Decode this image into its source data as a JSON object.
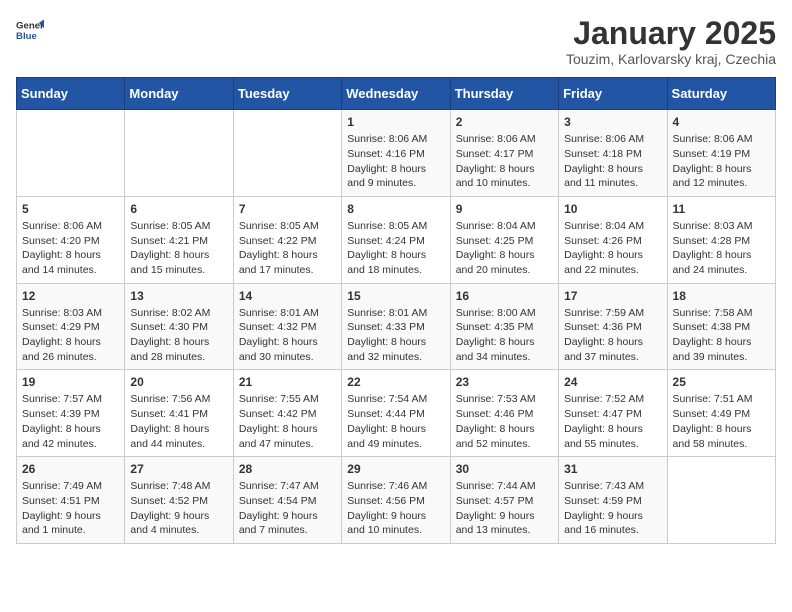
{
  "header": {
    "logo_general": "General",
    "logo_blue": "Blue",
    "month_title": "January 2025",
    "location": "Touzim, Karlovarsky kraj, Czechia"
  },
  "days_of_week": [
    "Sunday",
    "Monday",
    "Tuesday",
    "Wednesday",
    "Thursday",
    "Friday",
    "Saturday"
  ],
  "weeks": [
    [
      {
        "day": "",
        "content": ""
      },
      {
        "day": "",
        "content": ""
      },
      {
        "day": "",
        "content": ""
      },
      {
        "day": "1",
        "content": "Sunrise: 8:06 AM\nSunset: 4:16 PM\nDaylight: 8 hours\nand 9 minutes."
      },
      {
        "day": "2",
        "content": "Sunrise: 8:06 AM\nSunset: 4:17 PM\nDaylight: 8 hours\nand 10 minutes."
      },
      {
        "day": "3",
        "content": "Sunrise: 8:06 AM\nSunset: 4:18 PM\nDaylight: 8 hours\nand 11 minutes."
      },
      {
        "day": "4",
        "content": "Sunrise: 8:06 AM\nSunset: 4:19 PM\nDaylight: 8 hours\nand 12 minutes."
      }
    ],
    [
      {
        "day": "5",
        "content": "Sunrise: 8:06 AM\nSunset: 4:20 PM\nDaylight: 8 hours\nand 14 minutes."
      },
      {
        "day": "6",
        "content": "Sunrise: 8:05 AM\nSunset: 4:21 PM\nDaylight: 8 hours\nand 15 minutes."
      },
      {
        "day": "7",
        "content": "Sunrise: 8:05 AM\nSunset: 4:22 PM\nDaylight: 8 hours\nand 17 minutes."
      },
      {
        "day": "8",
        "content": "Sunrise: 8:05 AM\nSunset: 4:24 PM\nDaylight: 8 hours\nand 18 minutes."
      },
      {
        "day": "9",
        "content": "Sunrise: 8:04 AM\nSunset: 4:25 PM\nDaylight: 8 hours\nand 20 minutes."
      },
      {
        "day": "10",
        "content": "Sunrise: 8:04 AM\nSunset: 4:26 PM\nDaylight: 8 hours\nand 22 minutes."
      },
      {
        "day": "11",
        "content": "Sunrise: 8:03 AM\nSunset: 4:28 PM\nDaylight: 8 hours\nand 24 minutes."
      }
    ],
    [
      {
        "day": "12",
        "content": "Sunrise: 8:03 AM\nSunset: 4:29 PM\nDaylight: 8 hours\nand 26 minutes."
      },
      {
        "day": "13",
        "content": "Sunrise: 8:02 AM\nSunset: 4:30 PM\nDaylight: 8 hours\nand 28 minutes."
      },
      {
        "day": "14",
        "content": "Sunrise: 8:01 AM\nSunset: 4:32 PM\nDaylight: 8 hours\nand 30 minutes."
      },
      {
        "day": "15",
        "content": "Sunrise: 8:01 AM\nSunset: 4:33 PM\nDaylight: 8 hours\nand 32 minutes."
      },
      {
        "day": "16",
        "content": "Sunrise: 8:00 AM\nSunset: 4:35 PM\nDaylight: 8 hours\nand 34 minutes."
      },
      {
        "day": "17",
        "content": "Sunrise: 7:59 AM\nSunset: 4:36 PM\nDaylight: 8 hours\nand 37 minutes."
      },
      {
        "day": "18",
        "content": "Sunrise: 7:58 AM\nSunset: 4:38 PM\nDaylight: 8 hours\nand 39 minutes."
      }
    ],
    [
      {
        "day": "19",
        "content": "Sunrise: 7:57 AM\nSunset: 4:39 PM\nDaylight: 8 hours\nand 42 minutes."
      },
      {
        "day": "20",
        "content": "Sunrise: 7:56 AM\nSunset: 4:41 PM\nDaylight: 8 hours\nand 44 minutes."
      },
      {
        "day": "21",
        "content": "Sunrise: 7:55 AM\nSunset: 4:42 PM\nDaylight: 8 hours\nand 47 minutes."
      },
      {
        "day": "22",
        "content": "Sunrise: 7:54 AM\nSunset: 4:44 PM\nDaylight: 8 hours\nand 49 minutes."
      },
      {
        "day": "23",
        "content": "Sunrise: 7:53 AM\nSunset: 4:46 PM\nDaylight: 8 hours\nand 52 minutes."
      },
      {
        "day": "24",
        "content": "Sunrise: 7:52 AM\nSunset: 4:47 PM\nDaylight: 8 hours\nand 55 minutes."
      },
      {
        "day": "25",
        "content": "Sunrise: 7:51 AM\nSunset: 4:49 PM\nDaylight: 8 hours\nand 58 minutes."
      }
    ],
    [
      {
        "day": "26",
        "content": "Sunrise: 7:49 AM\nSunset: 4:51 PM\nDaylight: 9 hours\nand 1 minute."
      },
      {
        "day": "27",
        "content": "Sunrise: 7:48 AM\nSunset: 4:52 PM\nDaylight: 9 hours\nand 4 minutes."
      },
      {
        "day": "28",
        "content": "Sunrise: 7:47 AM\nSunset: 4:54 PM\nDaylight: 9 hours\nand 7 minutes."
      },
      {
        "day": "29",
        "content": "Sunrise: 7:46 AM\nSunset: 4:56 PM\nDaylight: 9 hours\nand 10 minutes."
      },
      {
        "day": "30",
        "content": "Sunrise: 7:44 AM\nSunset: 4:57 PM\nDaylight: 9 hours\nand 13 minutes."
      },
      {
        "day": "31",
        "content": "Sunrise: 7:43 AM\nSunset: 4:59 PM\nDaylight: 9 hours\nand 16 minutes."
      },
      {
        "day": "",
        "content": ""
      }
    ]
  ]
}
